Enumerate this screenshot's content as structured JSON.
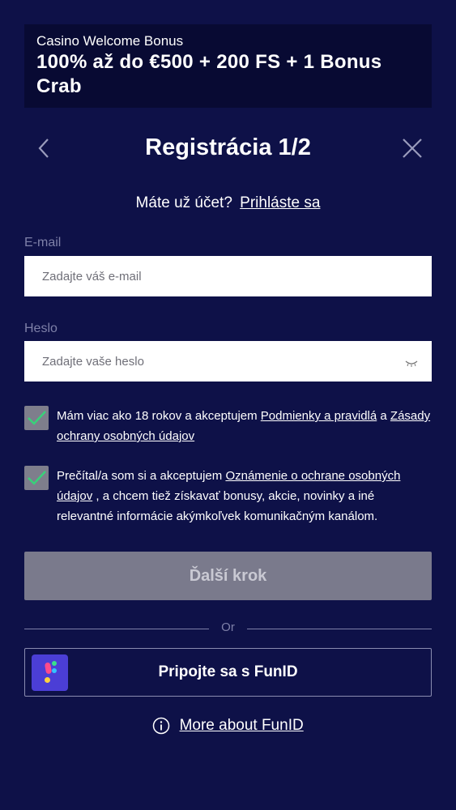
{
  "banner": {
    "subtitle": "Casino Welcome Bonus",
    "headline": "100% až do €500 + 200 FS + 1 Bonus Crab"
  },
  "header": {
    "title": "Registrácia 1/2",
    "back_icon": "chevron-left-icon",
    "close_icon": "close-icon"
  },
  "login": {
    "question": "Máte už účet?",
    "link": "Prihláste sa"
  },
  "form": {
    "email": {
      "label": "E-mail",
      "placeholder": "Zadajte váš e-mail",
      "value": ""
    },
    "password": {
      "label": "Heslo",
      "placeholder": "Zadajte vaše heslo",
      "value": "",
      "toggle_icon": "eye-closed-icon"
    }
  },
  "consents": [
    {
      "checked": true,
      "text1": "Mám viac ako 18 rokov a akceptujem",
      "link1": "Podmienky a pravidlá",
      "text2": "a",
      "link2": "Zásady ochrany osobných údajov",
      "text3": ""
    },
    {
      "checked": true,
      "text1": "Prečítal/a som si a akceptujem",
      "link1": "Oznámenie o ochrane osobných údajov",
      "text2": ", a chcem tiež získavať bonusy, akcie, novinky a iné relevantné informácie akýmkoľvek komunikačným kanálom.",
      "link2": "",
      "text3": ""
    }
  ],
  "next_button": {
    "label": "Ďalší krok",
    "enabled": false
  },
  "divider": {
    "label": "Or"
  },
  "funid": {
    "button_label": "Pripojte sa s FunID",
    "more_link": "More about FunID",
    "info_icon": "info-icon"
  },
  "colors": {
    "background": "#0e1148",
    "banner": "#080a33",
    "disabled_button": "#7a7a8c",
    "check_mark": "#38d27a",
    "funid_logo": "#4b3ed6"
  }
}
